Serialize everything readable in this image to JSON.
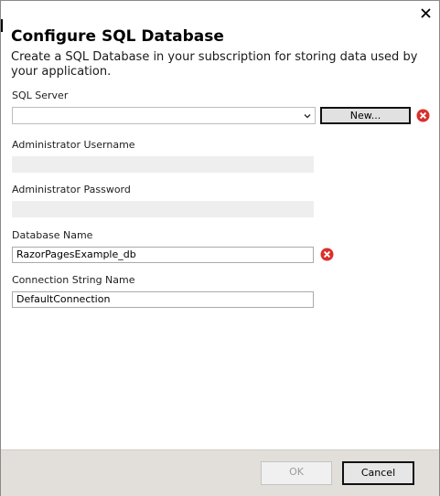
{
  "dialog": {
    "title": "Configure SQL Database",
    "subtitle": "Create a SQL Database in your subscription for storing data used by your application.",
    "close_icon": "close-icon"
  },
  "sql_server": {
    "label": "SQL Server",
    "selected_value": "",
    "new_button_label": "New...",
    "has_error": true
  },
  "admin_username": {
    "label": "Administrator Username",
    "value": "",
    "disabled": true
  },
  "admin_password": {
    "label": "Administrator Password",
    "value": "",
    "disabled": true
  },
  "database_name": {
    "label": "Database Name",
    "value": "RazorPagesExample_db",
    "has_error": true
  },
  "connection_string": {
    "label": "Connection String Name",
    "value": "DefaultConnection"
  },
  "footer": {
    "ok_label": "OK",
    "ok_enabled": false,
    "cancel_label": "Cancel"
  },
  "colors": {
    "error_red": "#d9302c",
    "footer_bg": "#e2dfda",
    "disabled_field_bg": "#eeeeee"
  }
}
